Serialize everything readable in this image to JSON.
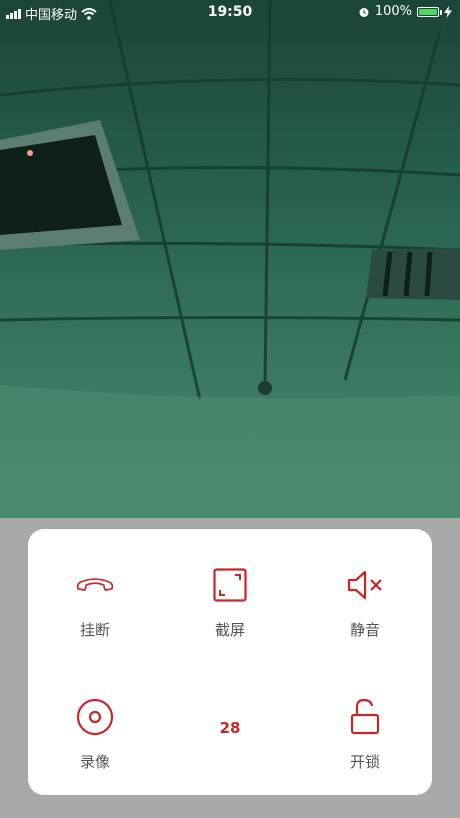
{
  "status_bar": {
    "carrier": "中国移动",
    "time": "19:50",
    "battery": "100%"
  },
  "controls": {
    "hangup_label": "挂断",
    "screenshot_label": "截屏",
    "mute_label": "静音",
    "record_label": "录像",
    "unlock_label": "开锁",
    "timer": "28"
  },
  "colors": {
    "accent": "#c62828",
    "label": "#555555",
    "panel_bg": "#ffffff",
    "page_bg": "#a9a9a9"
  }
}
